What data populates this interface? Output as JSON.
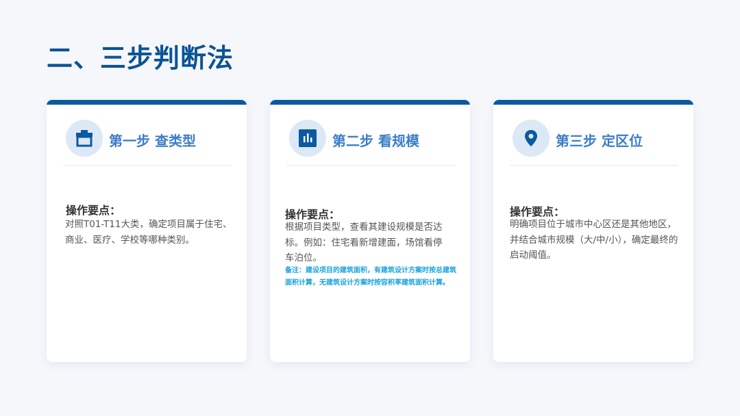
{
  "page": {
    "title": "二、三步判断法"
  },
  "colors": {
    "accent": "#0b5aa0",
    "heading": "#3b7dc7",
    "note": "#1aa3de"
  },
  "cards": [
    {
      "icon": "toolbox-icon",
      "heading": "第一步 查类型",
      "label": "操作要点：",
      "desc": "对照T01-T11大类，确定项目属于住宅、商业、医疗、学校等哪种类别。"
    },
    {
      "icon": "bar-chart-icon",
      "heading": "第二步 看规模",
      "label": "操作要点：",
      "desc": "根据项目类型，查看其建设规模是否达标。例如：住宅看新增建面，场馆看停车泊位。",
      "note": "备注：建设项目的建筑面积，有建筑设计方案时按总建筑面积计算，无建筑设计方案时按容积率建筑面积计算。"
    },
    {
      "icon": "location-pin-icon",
      "heading": "第三步 定区位",
      "label": "操作要点：",
      "desc": "明确项目位于城市中心区还是其他地区，并结合城市规模（大/中/小），确定最终的启动阈值。"
    }
  ]
}
